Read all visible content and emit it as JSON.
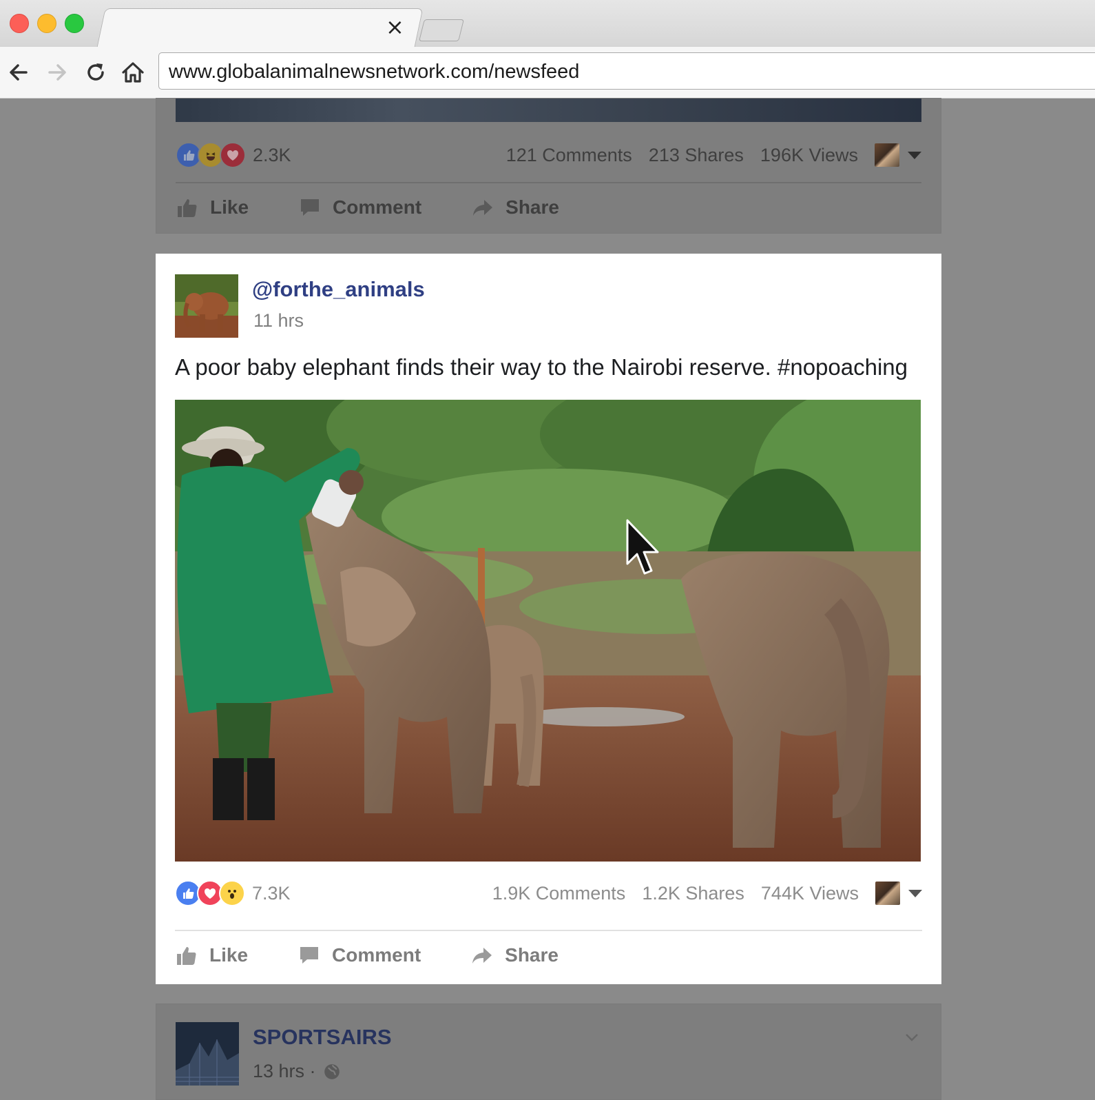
{
  "browser": {
    "url": "www.globalanimalnewsnetwork.com/newsfeed",
    "tab_close_glyph": "×",
    "icons": [
      "back-arrow-icon",
      "forward-arrow-icon",
      "reload-icon",
      "home-icon"
    ]
  },
  "feed": {
    "previous_post": {
      "reactions": [
        "like",
        "haha",
        "love"
      ],
      "reaction_count": "2.3K",
      "comments": "121 Comments",
      "shares": "213 Shares",
      "views": "196K Views",
      "actions": {
        "like": "Like",
        "comment": "Comment",
        "share": "Share"
      }
    },
    "post": {
      "author": "@forthe_animals",
      "time": "11 hrs",
      "text": "A poor baby elephant finds their way to the Nairobi reserve. #nopoaching",
      "reactions": [
        "like",
        "love",
        "wow"
      ],
      "reaction_count": "7.3K",
      "comments": "1.9K Comments",
      "shares": "1.2K Shares",
      "views": "744K Views",
      "actions": {
        "like": "Like",
        "comment": "Comment",
        "share": "Share"
      }
    },
    "next_post": {
      "author": "SPORTSAIRS",
      "time": "13 hrs ·"
    }
  },
  "colors": {
    "author_link": "#2f3f83",
    "like_blue": "#4a7ff0",
    "love_red": "#f0435a",
    "wow_yellow": "#fcd34a",
    "overlay_gray": "#8a8a8a"
  }
}
